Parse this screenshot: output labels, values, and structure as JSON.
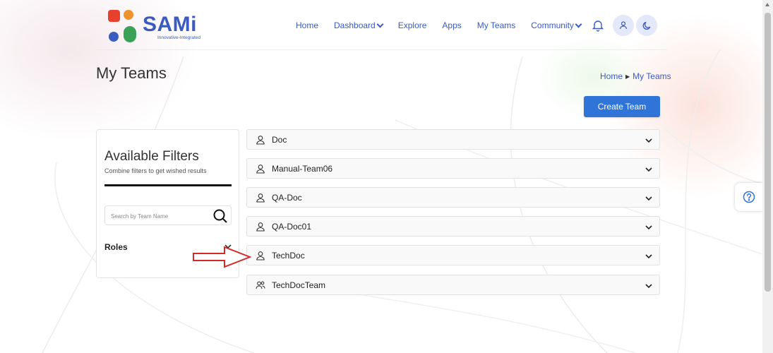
{
  "brand": {
    "name": "SAMi",
    "tagline": "Innovative-Integrated"
  },
  "nav": {
    "items": [
      {
        "label": "Home",
        "dropdown": false
      },
      {
        "label": "Dashboard",
        "dropdown": true
      },
      {
        "label": "Explore",
        "dropdown": false
      },
      {
        "label": "Apps",
        "dropdown": false
      },
      {
        "label": "My Teams",
        "dropdown": false
      },
      {
        "label": "Community",
        "dropdown": true
      }
    ],
    "icons": [
      "bell-icon",
      "user-icon",
      "moon-icon"
    ]
  },
  "page": {
    "title": "My Teams",
    "breadcrumb": [
      "Home",
      "My Teams"
    ],
    "create_button": "Create Team"
  },
  "filters": {
    "title": "Available Filters",
    "subtitle": "Combine filters to get wished results",
    "search_placeholder": "Search by Team Name",
    "search_value": "",
    "roles_label": "Roles"
  },
  "teams": [
    {
      "name": "Doc",
      "icon": "user-icon"
    },
    {
      "name": "Manual-Team06",
      "icon": "user-icon"
    },
    {
      "name": "QA-Doc",
      "icon": "user-icon"
    },
    {
      "name": "QA-Doc01",
      "icon": "user-icon"
    },
    {
      "name": "TechDoc",
      "icon": "user-icon"
    },
    {
      "name": "TechDocTeam",
      "icon": "users-icon"
    }
  ],
  "colors": {
    "accent": "#3b5bbf",
    "button": "#2f74d6",
    "annotation_arrow": "#d42a2a",
    "logo_orange": "#f0922b",
    "logo_green": "#3aa257",
    "logo_red": "#e8402f",
    "logo_blue": "#3b5bbf"
  }
}
